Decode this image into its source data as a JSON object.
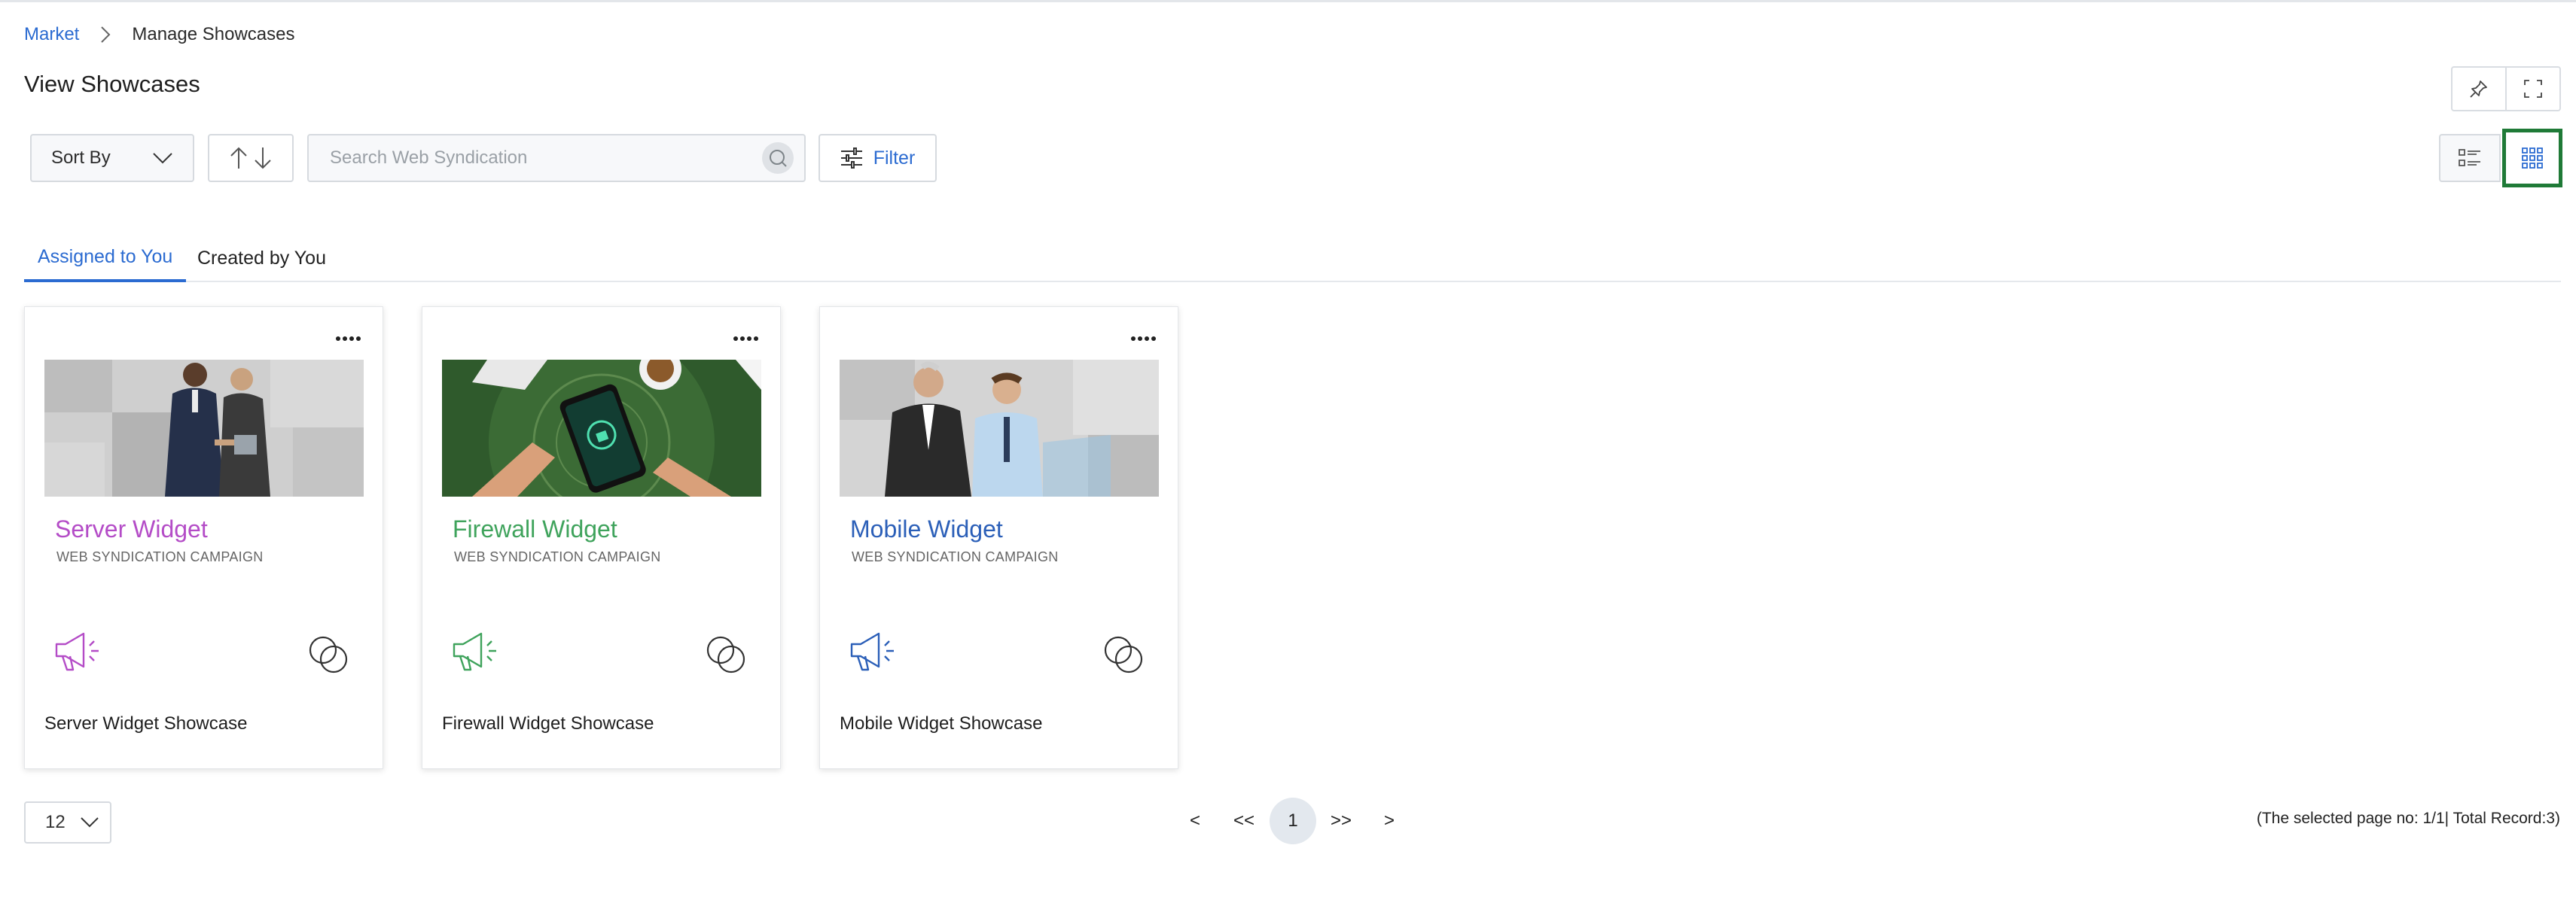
{
  "breadcrumb": {
    "parent": "Market",
    "current": "Manage Showcases"
  },
  "page_title": "View Showcases",
  "toolbar": {
    "sort_label": "Sort By",
    "search_placeholder": "Search Web Syndication",
    "search_value": "",
    "filter_label": "Filter",
    "active_view": "grid"
  },
  "tabs": [
    {
      "label": "Assigned to You",
      "active": true
    },
    {
      "label": "Created by You",
      "active": false
    }
  ],
  "cards": [
    {
      "title": "Server Widget",
      "subtitle": "WEB SYNDICATION CAMPAIGN",
      "name": "Server Widget Showcase",
      "accent": "#b44cc7",
      "image": "two-businessmen-handshake"
    },
    {
      "title": "Firewall Widget",
      "subtitle": "WEB SYNDICATION CAMPAIGN",
      "name": "Firewall Widget Showcase",
      "accent": "#3fa35c",
      "image": "hands-holding-phone-security"
    },
    {
      "title": "Mobile Widget",
      "subtitle": "WEB SYNDICATION CAMPAIGN",
      "name": "Mobile Widget Showcase",
      "accent": "#2b5fb8",
      "image": "two-businessmen-laptop"
    }
  ],
  "pagination": {
    "page_size": "12",
    "prev": "<",
    "first": "<<",
    "current": "1",
    "last": ">>",
    "next": ">",
    "info": "(The selected page no: 1/1| Total Record:3)"
  },
  "colors": {
    "link": "#2b6bd1",
    "grid_highlight": "#1f7a37"
  }
}
